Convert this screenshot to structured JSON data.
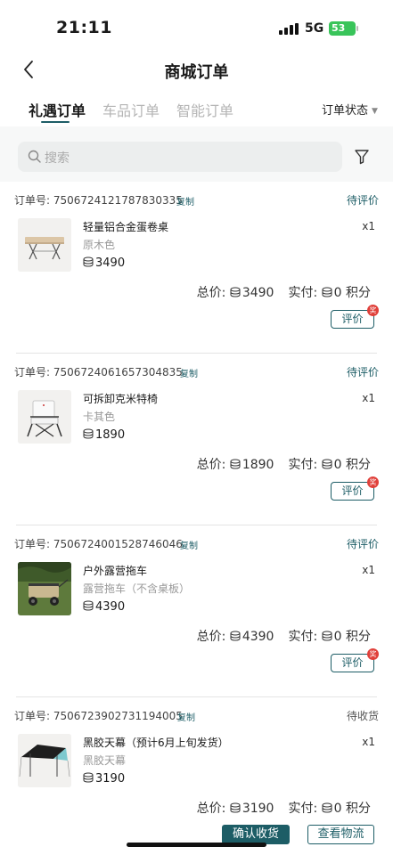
{
  "status_bar": {
    "time": "21:11",
    "network": "5G",
    "battery": "53"
  },
  "nav": {
    "title": "商城订单"
  },
  "tabs": [
    {
      "label": "礼遇订单",
      "active": true
    },
    {
      "label": "车品订单",
      "active": false
    },
    {
      "label": "智能订单",
      "active": false
    }
  ],
  "status_filter": {
    "label": "订单状态"
  },
  "search": {
    "placeholder": "搜索"
  },
  "labels": {
    "order_prefix": "订单号: ",
    "copy": "复制",
    "total": "总价:",
    "paid": "实付:",
    "points": "积分"
  },
  "orders": [
    {
      "order_no": "7506724121787830335",
      "status": "待评价",
      "product_name": "轻量铝合金蛋卷桌",
      "variant": "原木色",
      "price": "3490",
      "qty": "x1",
      "total": "3490",
      "paid": "0",
      "action": "评价",
      "badge": "奖"
    },
    {
      "order_no": "7506724061657304835",
      "status": "待评价",
      "product_name": "可拆卸克米特椅",
      "variant": "卡其色",
      "price": "1890",
      "qty": "x1",
      "total": "1890",
      "paid": "0",
      "action": "评价",
      "badge": "奖"
    },
    {
      "order_no": "7506724001528746046",
      "status": "待评价",
      "product_name": "户外露营拖车",
      "variant": "露营拖车（不含桌板）",
      "price": "4390",
      "qty": "x1",
      "total": "4390",
      "paid": "0",
      "action": "评价",
      "badge": "奖"
    },
    {
      "order_no": "7506723902731194005",
      "status": "待收货",
      "product_name": "黑胶天幕（预计6月上旬发货）",
      "variant": "黑胶天幕",
      "price": "3190",
      "qty": "x1",
      "total": "3190",
      "paid": "0"
    }
  ],
  "bottom_actions": {
    "confirm": "确认收货",
    "logistics": "查看物流"
  },
  "colors": {
    "accent": "#1d5d66",
    "badge": "#e0413b",
    "battery": "#39c45a"
  }
}
